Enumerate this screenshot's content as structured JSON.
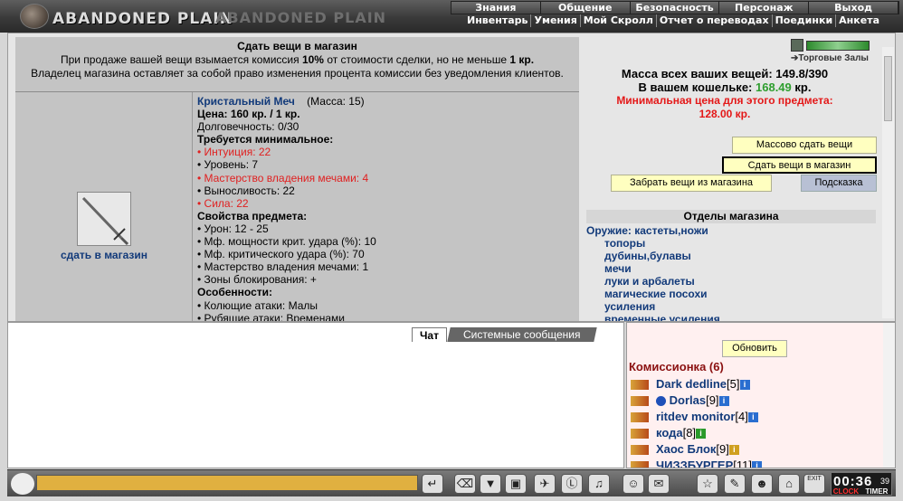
{
  "header": {
    "logo_text": "ABANDONED PLAIN",
    "ghost_text": "ABANDONED PLAIN",
    "menu_primary": [
      "Знания",
      "Общение",
      "Безопасность",
      "Персонаж",
      "Выход"
    ],
    "menu_secondary": [
      "Инвентарь",
      "Умения",
      "Мой Скролл",
      "Отчет о переводах",
      "Поединки",
      "Анкета"
    ]
  },
  "shop": {
    "title": "Сдать вещи в магазин",
    "notice_pre": "При продаже вашей вещи взымается комиссия ",
    "commission": "10%",
    "notice_mid": " от стоимости сделки, но не меньше ",
    "min_fee": "1 кр.",
    "notice_post": "Владелец магазина оставляет за собой право изменения процента комиссии без уведомления клиентов.",
    "sell_caption": "сдать в магазин"
  },
  "item": {
    "name": "Кристальный Меч",
    "mass_label": "(Масса: 15)",
    "price": "Цена: 160 кр. / 1 кр.",
    "durability": "Долговечность: 0/30",
    "req_title": "Требуется минимальное:",
    "requirements": [
      {
        "text": "• Интуиция: 22",
        "unmet": true
      },
      {
        "text": "• Уровень: 7",
        "unmet": false
      },
      {
        "text": "• Мастерство владения мечами: 4",
        "unmet": true
      },
      {
        "text": "• Выносливость: 22",
        "unmet": false
      },
      {
        "text": "• Сила: 22",
        "unmet": true
      }
    ],
    "props_title": "Свойства предмета:",
    "properties": [
      "• Урон: 12 - 25",
      "• Мф. мощности крит. удара (%): 10",
      "• Мф. критического удара (%): 70",
      "• Мастерство владения мечами: 1",
      "• Зоны блокирования: +"
    ],
    "feat_title": "Особенности:",
    "features": [
      "• Колющие атаки: Малы",
      "• Рубящие атаки: Временами"
    ]
  },
  "info": {
    "trade_halls": "Торговые Залы",
    "mass_text": "Масса всех ваших вещей: 149.8/390",
    "wallet_pre": "В вашем кошельке: ",
    "wallet_amount": "168.49",
    "wallet_post": " кр.",
    "min_price_label": "Минимальная цена для этого предмета:",
    "min_price_value": "128.00 кр."
  },
  "buttons": {
    "mass_sell": "Массово сдать вещи",
    "sell": "Сдать вещи в магазин",
    "take": "Забрать вещи из магазина",
    "hint": "Подсказка",
    "refresh": "Обновить"
  },
  "departments": {
    "title": "Отделы магазина",
    "first": "Оружие: кастеты,ножи",
    "items": [
      "топоры",
      "дубины,булавы",
      "мечи",
      "луки и арбалеты",
      "магические посохи",
      "усиления",
      "временные усиления"
    ]
  },
  "chat": {
    "tab_chat": "Чат",
    "tab_system": "Системные сообщения"
  },
  "room": {
    "name": "Комиссионка (6)",
    "users": [
      {
        "name": "Dark dedline",
        "level": "[5]"
      },
      {
        "name": "Dorlas",
        "level": "[9]"
      },
      {
        "name": "ritdev monitor",
        "level": "[4]"
      },
      {
        "name": "кода",
        "level": "[8]"
      },
      {
        "name": "Хаос Блок",
        "level": "[9]"
      },
      {
        "name": "ЧИЗЗБУРГЕР",
        "level": "[11]"
      }
    ]
  },
  "clock": {
    "time": "00:36",
    "seconds": "39",
    "clock_label": "CLOCK",
    "timer_label": "TIMER",
    "exit_label": "EXIT"
  },
  "toolbar": {
    "icons": [
      "enter-icon",
      "eraser-icon",
      "filter-icon",
      "save-icon",
      "walk-icon",
      "translit-icon",
      "music-icon",
      "smile-icon",
      "bag-icon",
      "friends-icon",
      "edit-icon",
      "group-icon",
      "home-icon",
      "exit-icon"
    ]
  }
}
